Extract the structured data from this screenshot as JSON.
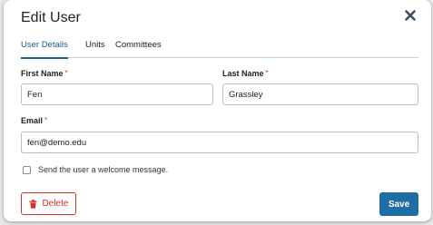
{
  "dialog": {
    "title": "Edit User"
  },
  "tabs": [
    {
      "label": "User Details",
      "active": true
    },
    {
      "label": "Units",
      "active": false
    },
    {
      "label": "Committees",
      "active": false
    }
  ],
  "form": {
    "first_name_label": "First Name",
    "first_name_value": "Fen",
    "last_name_label": "Last Name",
    "last_name_value": "Grassley",
    "email_label": "Email",
    "email_value": "fen@demo.edu",
    "required_marker": "*",
    "welcome_checkbox_label": "Send the user a welcome message.",
    "welcome_checked": false
  },
  "actions": {
    "delete_label": "Delete",
    "save_label": "Save"
  },
  "icons": {
    "close": "close-icon",
    "delete": "trash-icon"
  },
  "colors": {
    "accent": "#1b5f8f",
    "save_button": "#1f6ea3",
    "danger": "#d2322d"
  }
}
